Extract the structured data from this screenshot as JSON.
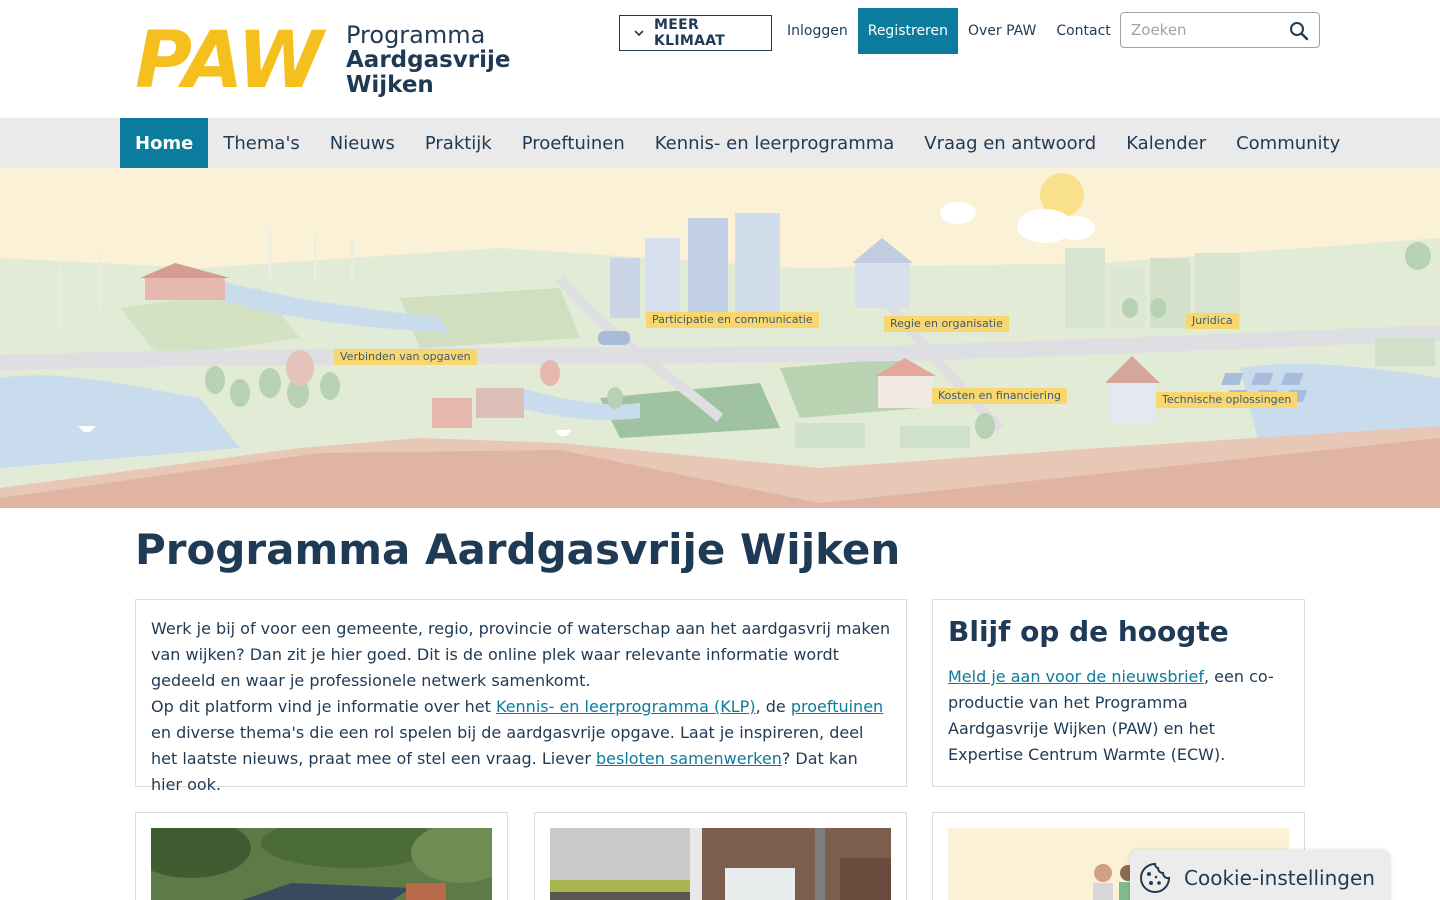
{
  "logo": {
    "mark": "PAW",
    "line1": "Programma",
    "line2": "Aardgasvrije",
    "line3": "Wijken"
  },
  "top_nav": {
    "meer_klimaat": "MEER KLIMAAT",
    "inloggen": "Inloggen",
    "registreren": "Registreren",
    "over": "Over PAW",
    "contact": "Contact"
  },
  "search": {
    "placeholder": "Zoeken",
    "value": ""
  },
  "main_nav": [
    {
      "label": "Home",
      "active": true
    },
    {
      "label": "Thema's"
    },
    {
      "label": "Nieuws"
    },
    {
      "label": "Praktijk"
    },
    {
      "label": "Proeftuinen"
    },
    {
      "label": "Kennis- en leerprogramma"
    },
    {
      "label": "Vraag en antwoord"
    },
    {
      "label": "Kalender"
    },
    {
      "label": "Community"
    }
  ],
  "hero_labels": {
    "participatie": "Participatie en communicatie",
    "regie": "Regie en organisatie",
    "juridica": "Juridica",
    "verbinden": "Verbinden van opgaven",
    "kosten": "Kosten en financiering",
    "technische": "Technische oplossingen"
  },
  "page_title": "Programma Aardgasvrije Wijken",
  "intro": {
    "p1": "Werk je bij of voor een gemeente, regio, provincie of waterschap aan het aardgasvrij maken van wijken? Dan zit je hier goed. Dit is de online plek waar relevante informatie wordt gedeeld en waar je professionele netwerk samenkomt.",
    "p2_a": "Op dit platform vind je informatie over het ",
    "p2_link1": "Kennis- en leerprogramma (KLP)",
    "p2_b": ", de ",
    "p2_link2": "proeftuinen",
    "p2_c": " en diverse thema's die een rol spelen bij de aardgasvrije opgave. Laat je inspireren, deel het laatste nieuws, praat mee of stel een vraag. Liever ",
    "p2_link3": "besloten samenwerken",
    "p2_d": "? Dat kan hier ook."
  },
  "newsletter": {
    "title": "Blijf op de hoogte",
    "link": "Meld je aan voor de nieuwsbrief",
    "text": ", een co-productie van het Programma Aardgasvrije Wijken (PAW) en het Expertise Centrum Warmte (ECW)."
  },
  "cookie": {
    "label": "Cookie-instellingen"
  },
  "colors": {
    "brand_yellow": "#f5bf1d",
    "brand_navy": "#1f3a55",
    "accent_teal": "#0b7c9e",
    "nav_bg": "#eaeaea"
  }
}
